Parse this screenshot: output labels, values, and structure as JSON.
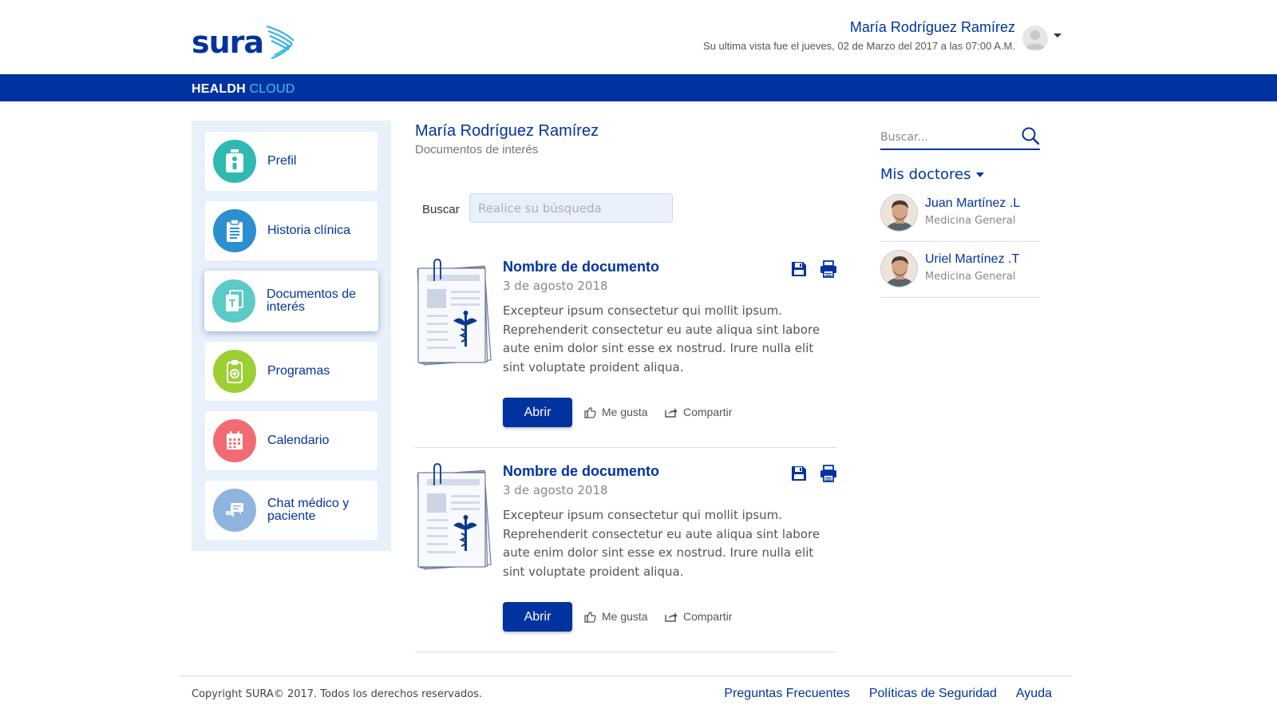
{
  "header": {
    "logo_text": "sura",
    "user_name": "María Rodríguez Ramírez",
    "last_visit": "Su ultima vista fue el jueves, 02 de Marzo del 2017 a las 07:00 A.M."
  },
  "brand": {
    "primary": "HEALDH",
    "accent": "CLOUD"
  },
  "sidebar": {
    "items": [
      {
        "label": "Prefil",
        "icon": "person-badge-icon",
        "color": "#2fb9b0"
      },
      {
        "label": "Historia clínica",
        "icon": "clipboard-icon",
        "color": "#2c8fd0"
      },
      {
        "label": "Documentos de interés",
        "icon": "documents-icon",
        "color": "#5ccac7"
      },
      {
        "label": "Programas",
        "icon": "clipboard-plus-icon",
        "color": "#9ccf33"
      },
      {
        "label": "Calendario",
        "icon": "calendar-icon",
        "color": "#f26b73"
      },
      {
        "label": "Chat médico y paciente",
        "icon": "chat-icon",
        "color": "#8fb4de"
      }
    ]
  },
  "main": {
    "title": "María Rodríguez Ramírez",
    "subtitle": "Documentos de interés",
    "search_label": "Buscar",
    "search_placeholder": "Realice su búsqueda",
    "documents": [
      {
        "title": "Nombre de documento",
        "date": "3 de agosto 2018",
        "text": "Excepteur ipsum consectetur qui mollit ipsum. Reprehenderit consectetur eu aute aliqua sint labore aute enim dolor sint esse ex nostrud. Irure nulla elit sint voluptate proident aliqua.",
        "open_label": "Abrir",
        "like_label": "Me gusta",
        "share_label": "Compartir"
      },
      {
        "title": "Nombre de documento",
        "date": "3 de agosto 2018",
        "text": "Excepteur ipsum consectetur qui mollit ipsum. Reprehenderit consectetur eu aute aliqua sint labore aute enim dolor sint esse ex nostrud. Irure nulla elit sint voluptate proident aliqua.",
        "open_label": "Abrir",
        "like_label": "Me gusta",
        "share_label": "Compartir"
      }
    ]
  },
  "right": {
    "search_placeholder": "Buscar...",
    "doctors_title": "Mis doctores",
    "doctors": [
      {
        "name": "Juan Martínez .L",
        "specialty": "Medicina General"
      },
      {
        "name": "Uriel Martínez .T",
        "specialty": "Medicina General"
      }
    ]
  },
  "footer": {
    "copyright": "Copyright SURA© 2017. Todos los derechos reservados.",
    "links": [
      "Preguntas Frecuentes",
      "Políticas de Seguridad",
      "Ayuda"
    ]
  },
  "colors": {
    "brand_blue": "#0033a0",
    "accent_cyan": "#3ec6f0",
    "sidebar_bg": "#e8f0fb"
  }
}
